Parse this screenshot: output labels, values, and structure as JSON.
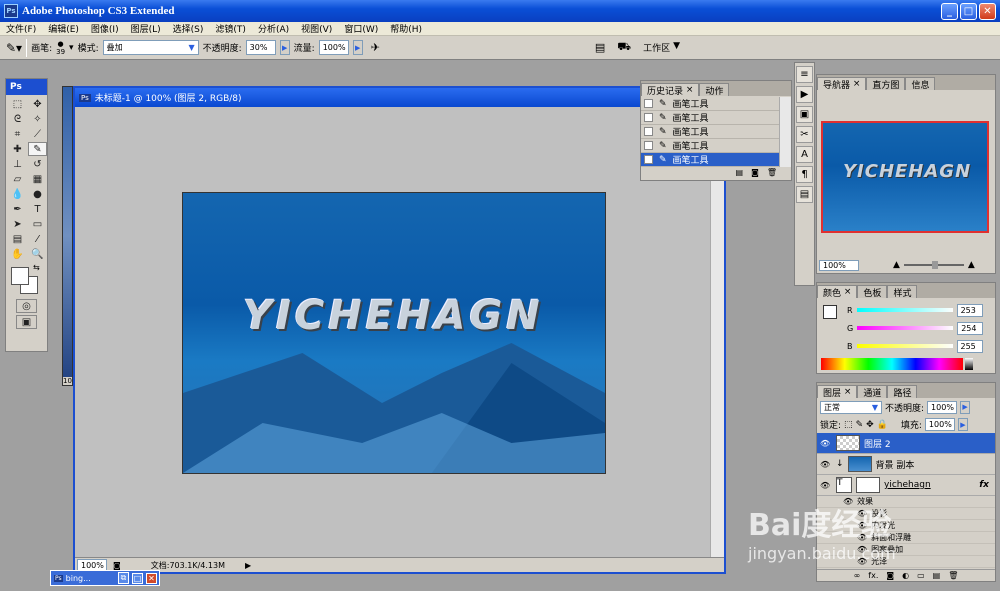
{
  "app": {
    "title": "Adobe Photoshop CS3 Extended",
    "logo": "Ps"
  },
  "menu": [
    "文件(F)",
    "编辑(E)",
    "图像(I)",
    "图层(L)",
    "选择(S)",
    "滤镜(T)",
    "分析(A)",
    "视图(V)",
    "窗口(W)",
    "帮助(H)"
  ],
  "options": {
    "brush_label": "画笔:",
    "brush_size": "39",
    "mode_label": "模式:",
    "mode_value": "叠加",
    "opacity_label": "不透明度:",
    "opacity_value": "30%",
    "flow_label": "流量:",
    "flow_value": "100%",
    "workspace_label": "工作区"
  },
  "toolbox": {
    "header": "Ps"
  },
  "document": {
    "title": "未标题-1 @ 100% (图层 2, RGB/8)",
    "art_text": "YICHEHAGN",
    "zoom": "100%",
    "doc_info": "文档:703.1K/4.13M",
    "side_zoom": "10"
  },
  "history": {
    "tabs": [
      "历史记录",
      "动作"
    ],
    "items": [
      "画笔工具",
      "画笔工具",
      "画笔工具",
      "画笔工具",
      "画笔工具"
    ]
  },
  "navigator": {
    "tabs": [
      "导航器",
      "直方图",
      "信息"
    ],
    "zoom": "100%",
    "thumb_text": "YICHEHAGN"
  },
  "color": {
    "tabs": [
      "颜色",
      "色板",
      "样式"
    ],
    "channels": [
      {
        "label": "R",
        "value": "253"
      },
      {
        "label": "G",
        "value": "254"
      },
      {
        "label": "B",
        "value": "255"
      }
    ]
  },
  "layers": {
    "tabs": [
      "图层",
      "通道",
      "路径"
    ],
    "blend_mode": "正常",
    "opacity_label": "不透明度:",
    "opacity_value": "100%",
    "lock_label": "锁定:",
    "fill_label": "填充:",
    "fill_value": "100%",
    "rows": [
      {
        "name": "图层 2"
      },
      {
        "name": "背景 副本"
      },
      {
        "name": "yichehagn"
      }
    ],
    "effects": [
      "效果",
      "投影",
      "内发光",
      "斜面和浮雕",
      "图案叠加",
      "光泽"
    ]
  },
  "taskbar": {
    "item_label": "bing..."
  },
  "watermark": {
    "text": "Bai度经验",
    "sub": "jingyan.baidu.com"
  }
}
